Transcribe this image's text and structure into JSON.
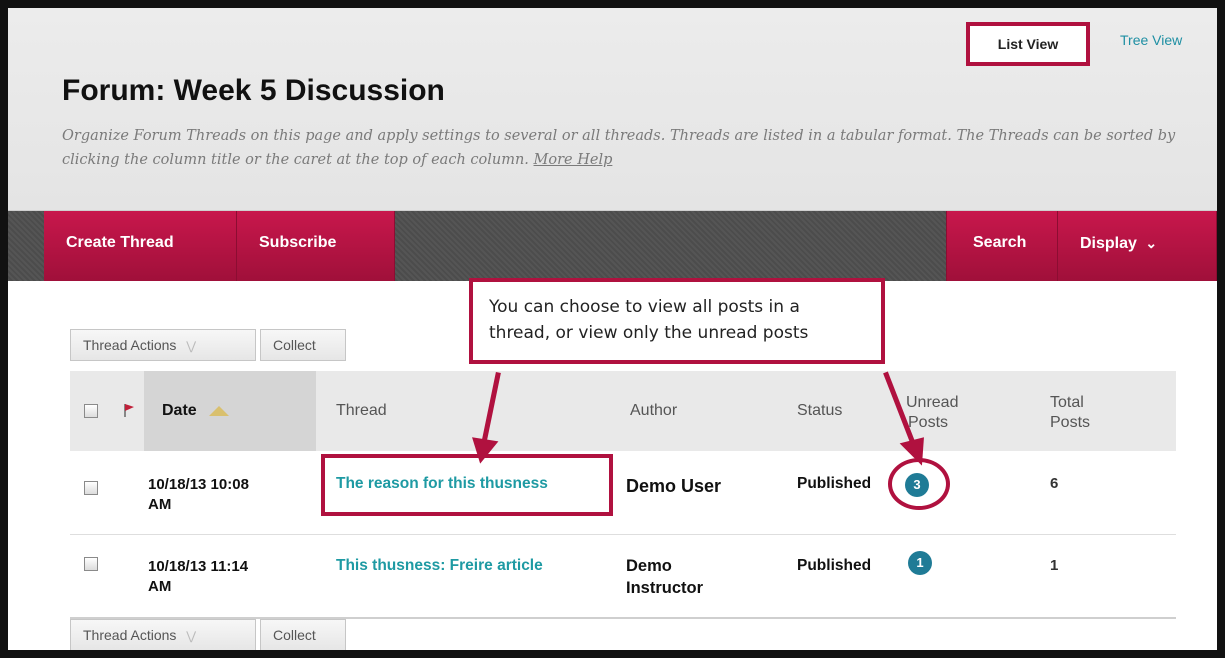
{
  "header": {
    "title": "Forum: Week 5 Discussion",
    "description": "Organize Forum Threads on this page and apply settings to several or all threads. Threads are listed in a tabular format. The Threads can be sorted by clicking the column title or the caret at the top of each column.",
    "more_help": "More Help",
    "view_list": "List View",
    "view_tree": "Tree View"
  },
  "action_bar": {
    "create_thread": "Create Thread",
    "subscribe": "Subscribe",
    "search": "Search",
    "display": "Display"
  },
  "toolbar": {
    "thread_actions": "Thread Actions",
    "collect": "Collect"
  },
  "table": {
    "headers": {
      "date": "Date",
      "thread": "Thread",
      "author": "Author",
      "status": "Status",
      "unread_line1": "Unread",
      "unread_line2": "Posts",
      "total_line1": "Total",
      "total_line2": "Posts"
    },
    "rows": [
      {
        "date_line1": "10/18/13 10:08",
        "date_line2": "AM",
        "thread": "The reason for this thusness",
        "author_line1": "Demo User",
        "author_line2": "",
        "status": "Published",
        "unread": "3",
        "total": "6"
      },
      {
        "date_line1": "10/18/13 11:14",
        "date_line2": "AM",
        "thread": "This thusness: Freire article",
        "author_line1": "Demo",
        "author_line2": "Instructor",
        "status": "Published",
        "unread": "1",
        "total": "1"
      }
    ]
  },
  "callout": {
    "line1": "You can choose to view all posts in a",
    "line2": "thread, or view only the unread posts"
  },
  "colors": {
    "accent": "#b0113f",
    "link": "#1e9aa3",
    "badge": "#1f7b96"
  }
}
